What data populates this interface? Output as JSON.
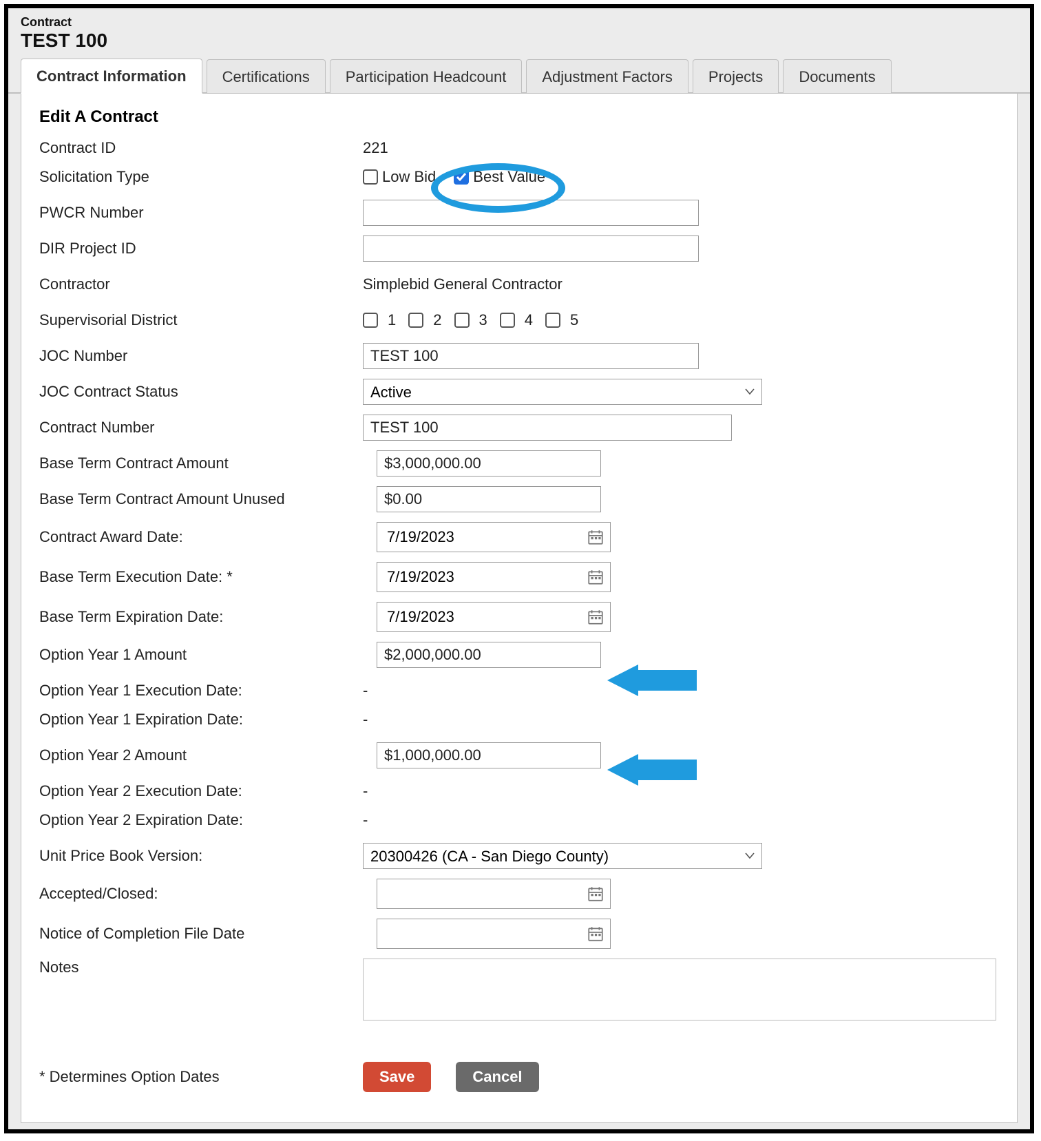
{
  "header": {
    "crumb": "Contract",
    "title": "TEST 100"
  },
  "tabs": [
    {
      "label": "Contract Information",
      "active": true
    },
    {
      "label": "Certifications",
      "active": false
    },
    {
      "label": "Participation Headcount",
      "active": false
    },
    {
      "label": "Adjustment Factors",
      "active": false
    },
    {
      "label": "Projects",
      "active": false
    },
    {
      "label": "Documents",
      "active": false
    }
  ],
  "section_title": "Edit A Contract",
  "labels": {
    "contract_id": "Contract ID",
    "solicitation_type": "Solicitation Type",
    "pwcr_number": "PWCR Number",
    "dir_project_id": "DIR Project ID",
    "contractor": "Contractor",
    "supervisorial_district": "Supervisorial District",
    "joc_number": "JOC Number",
    "joc_contract_status": "JOC Contract Status",
    "contract_number": "Contract Number",
    "base_term_amount": "Base Term Contract Amount",
    "base_term_amount_unused": "Base Term Contract Amount Unused",
    "contract_award_date": "Contract Award Date:",
    "base_term_exec_date": "Base Term Execution Date: *",
    "base_term_exp_date": "Base Term Expiration Date:",
    "opt1_amount": "Option Year 1 Amount",
    "opt1_exec": "Option Year 1 Execution Date:",
    "opt1_exp": "Option Year 1 Expiration Date:",
    "opt2_amount": "Option Year 2 Amount",
    "opt2_exec": "Option Year 2 Execution Date:",
    "opt2_exp": "Option Year 2 Expiration Date:",
    "unit_price_book": "Unit Price Book Version:",
    "accepted_closed": "Accepted/Closed:",
    "notice_completion": "Notice of Completion File Date",
    "notes": "Notes"
  },
  "values": {
    "contract_id": "221",
    "solicitation_low_bid_label": "Low Bid",
    "solicitation_best_value_label": "Best Value",
    "solicitation_low_bid_checked": false,
    "solicitation_best_value_checked": true,
    "pwcr_number": "",
    "dir_project_id": "",
    "contractor": "Simplebid General Contractor",
    "district_labels": [
      "1",
      "2",
      "3",
      "4",
      "5"
    ],
    "joc_number": "TEST 100",
    "joc_contract_status": "Active",
    "contract_number": "TEST 100",
    "base_term_amount": "$3,000,000.00",
    "base_term_amount_unused": "$0.00",
    "contract_award_date": "7/19/2023",
    "base_term_exec_date": "7/19/2023",
    "base_term_exp_date": "7/19/2023",
    "opt1_amount": "$2,000,000.00",
    "opt1_exec": "-",
    "opt1_exp": "-",
    "opt2_amount": "$1,000,000.00",
    "opt2_exec": "-",
    "opt2_exp": "-",
    "unit_price_book": "20300426 (CA - San Diego County)",
    "accepted_closed": "",
    "notice_completion": "",
    "notes": ""
  },
  "footnote": "* Determines Option Dates",
  "buttons": {
    "save": "Save",
    "cancel": "Cancel"
  }
}
